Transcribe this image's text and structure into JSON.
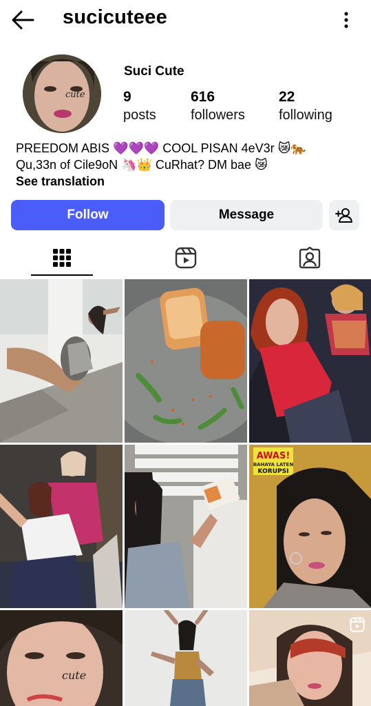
{
  "header": {
    "username": "sucicuteee",
    "back_icon": "arrow-left-icon",
    "more_icon": "more-vertical-icon"
  },
  "profile": {
    "full_name": "Suci Cute",
    "avatar_text": "cute",
    "stats": [
      {
        "value": "9",
        "label": "posts"
      },
      {
        "value": "616",
        "label": "followers"
      },
      {
        "value": "22",
        "label": "following"
      }
    ],
    "bio": {
      "line1": "PREEDOM ABIS 💜💜💜 COOL PISAN 4eV3r 😿🐅",
      "line2": "Qu,33n of Cile9oN 🦄👑 CuRhat? DM bae 😿",
      "see_translation": "See translation"
    }
  },
  "actions": {
    "follow_label": "Follow",
    "message_label": "Message",
    "add_user_icon": "add-user-icon"
  },
  "tabs": [
    {
      "name": "posts-grid",
      "icon": "grid-icon",
      "active": true
    },
    {
      "name": "reels",
      "icon": "reels-icon",
      "active": false
    },
    {
      "name": "tagged",
      "icon": "tagged-user-icon",
      "active": false
    }
  ],
  "posts": [
    {
      "kind": "photo",
      "scene": "woman posing on stone floor"
    },
    {
      "kind": "photo",
      "scene": "fried food on plate"
    },
    {
      "kind": "photo",
      "scene": "two women in red"
    },
    {
      "kind": "photo",
      "scene": "two women posing indoors"
    },
    {
      "kind": "photo",
      "scene": "woman near window holding box"
    },
    {
      "kind": "photo",
      "scene": "woman selfie",
      "sign_line1": "AWAS!",
      "sign_line2": "BAHAYA LATEN",
      "sign_line3": "KORUPSI"
    },
    {
      "kind": "photo",
      "scene": "close-up face",
      "face_text": "cute"
    },
    {
      "kind": "photo",
      "scene": "woman dancing"
    },
    {
      "kind": "reel",
      "scene": "woman selfie",
      "reel_icon": "reel-icon"
    }
  ],
  "colors": {
    "follow_button": "#4a5df9",
    "secondary_button": "#eff0f2"
  }
}
